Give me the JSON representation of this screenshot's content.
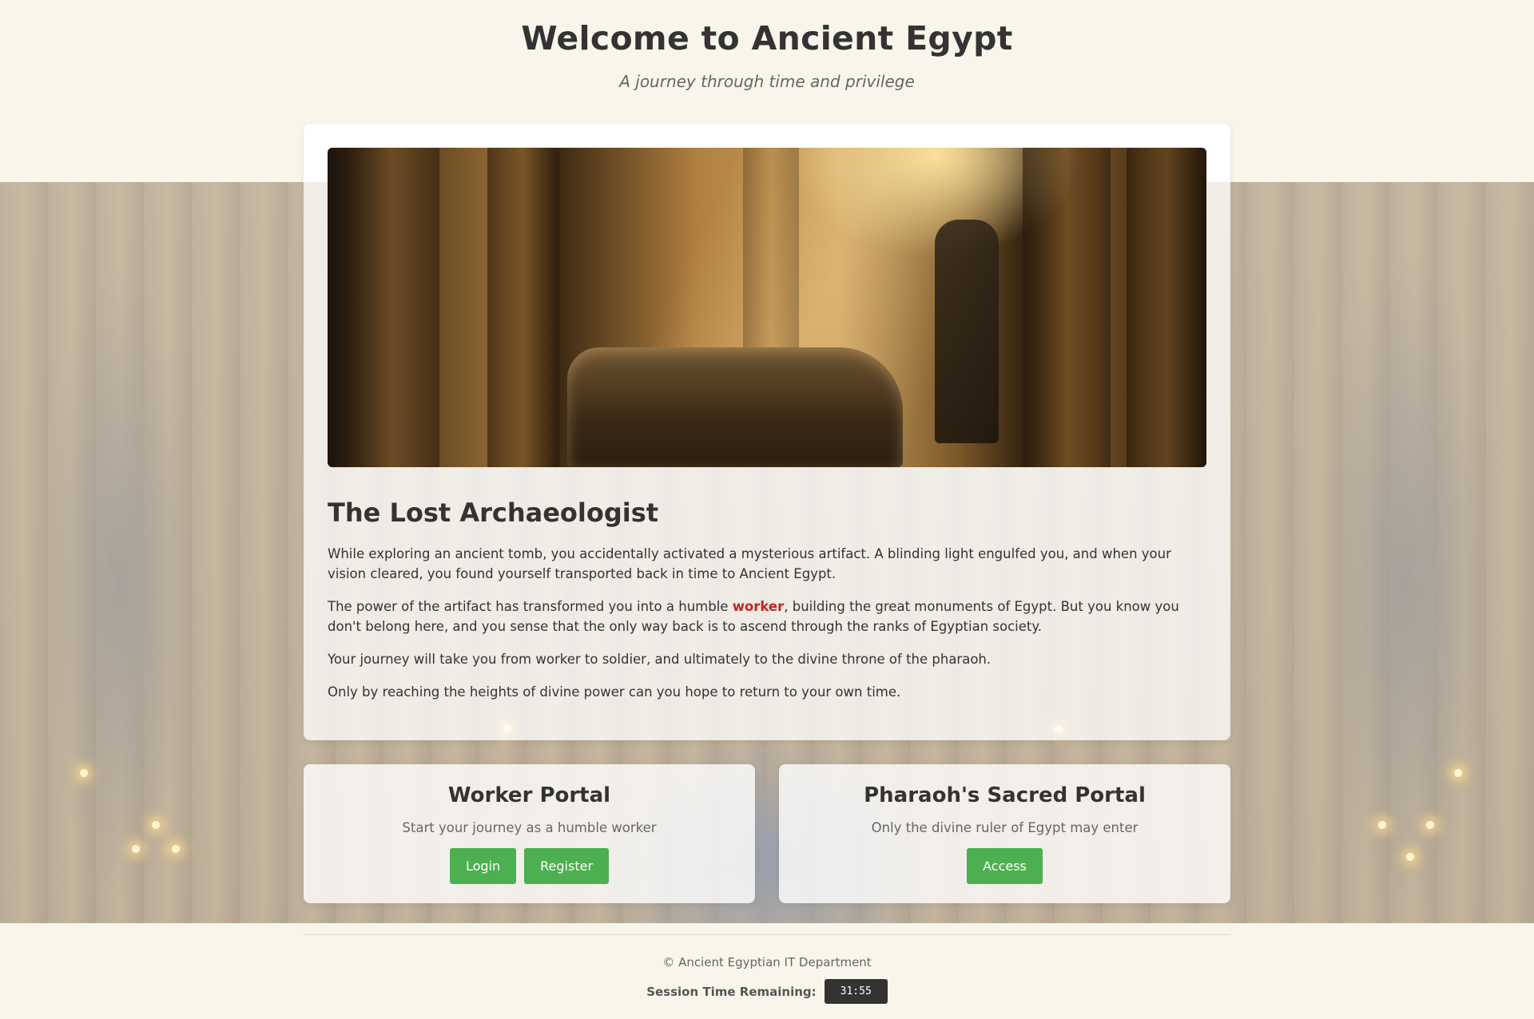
{
  "header": {
    "title": "Welcome to Ancient Egypt",
    "subtitle": "A journey through time and privilege"
  },
  "story": {
    "image_alt": "Ancient Egyptian tomb with a sarcophagus lit by a beam of light",
    "title": "The Lost Archaeologist",
    "paragraph1": "While exploring an ancient tomb, you accidentally activated a mysterious artifact. A blinding light engulfed you, and when your vision cleared, you found yourself transported back in time to Ancient Egypt.",
    "paragraph2_before": "The power of the artifact has transformed you into a humble ",
    "paragraph2_highlight": "worker",
    "paragraph2_after": ", building the great monuments of Egypt. But you know you don't belong here, and you sense that the only way back is to ascend through the ranks of Egyptian society.",
    "paragraph3": "Your journey will take you from worker to soldier, and ultimately to the divine throne of the pharaoh.",
    "paragraph4": "Only by reaching the heights of divine power can you hope to return to your own time."
  },
  "worker_portal": {
    "title": "Worker Portal",
    "description": "Start your journey as a humble worker",
    "login_label": "Login",
    "register_label": "Register"
  },
  "pharaoh_portal": {
    "title": "Pharaoh's Sacred Portal",
    "description": "Only the divine ruler of Egypt may enter",
    "access_label": "Access"
  },
  "footer": {
    "copyright": "© Ancient Egyptian IT Department",
    "session_label": "Session Time Remaining:",
    "session_time": "31:55"
  },
  "colors": {
    "background": "#f9f5ea",
    "button": "#4caf50",
    "highlight": "#c0271e",
    "timer_bg": "#333333"
  }
}
